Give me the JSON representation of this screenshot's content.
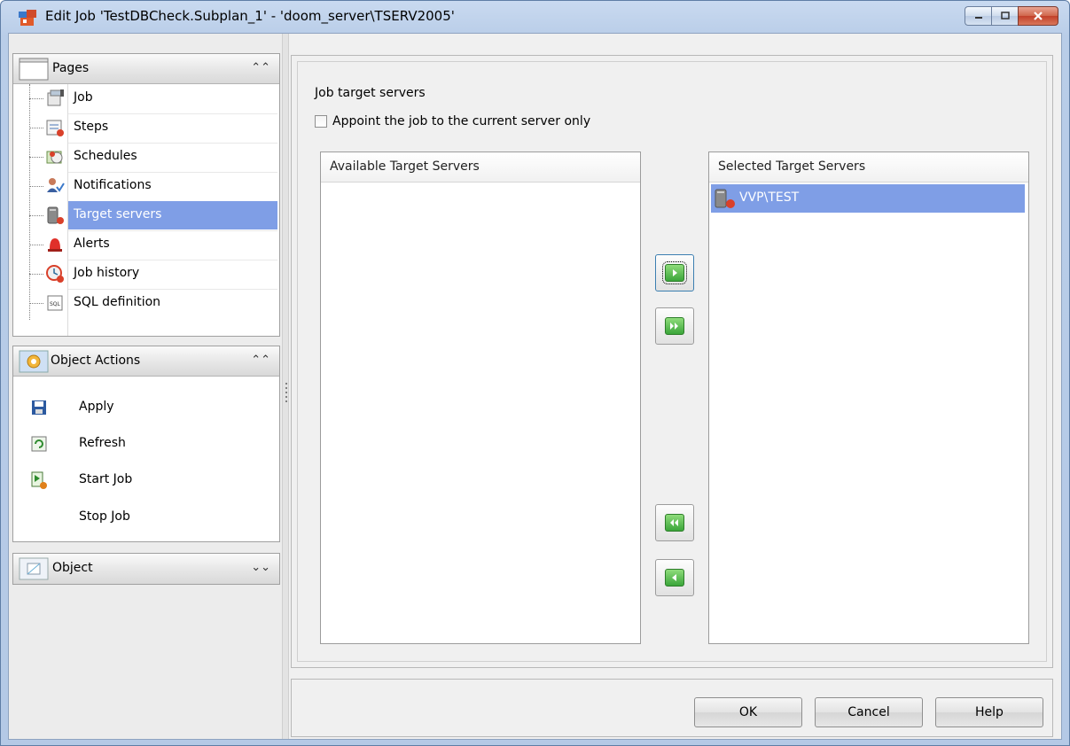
{
  "window": {
    "title": "Edit Job 'TestDBCheck.Subplan_1' - 'doom_server\\TSERV2005'"
  },
  "left_panel": {
    "pages": {
      "header": "Pages",
      "items": [
        {
          "label": "Job",
          "icon": "job-icon"
        },
        {
          "label": "Steps",
          "icon": "steps-icon"
        },
        {
          "label": "Schedules",
          "icon": "schedules-icon"
        },
        {
          "label": "Notifications",
          "icon": "notifications-icon"
        },
        {
          "label": "Target servers",
          "icon": "target-servers-icon",
          "selected": true
        },
        {
          "label": "Alerts",
          "icon": "alerts-icon"
        },
        {
          "label": "Job history",
          "icon": "job-history-icon"
        },
        {
          "label": "SQL definition",
          "icon": "sql-definition-icon"
        }
      ]
    },
    "object_actions": {
      "header": "Object Actions",
      "items": [
        {
          "label": "Apply",
          "icon": "save-icon"
        },
        {
          "label": "Refresh",
          "icon": "refresh-icon"
        },
        {
          "label": "Start Job",
          "icon": "start-job-icon"
        },
        {
          "label": "Stop Job",
          "icon": ""
        }
      ]
    },
    "object": {
      "header": "Object"
    }
  },
  "main": {
    "section_title": "Job target servers",
    "checkbox_label": "Appoint the job to the current server only",
    "checkbox_checked": false,
    "available_header": "Available Target Servers",
    "available_items": [],
    "selected_header": "Selected Target Servers",
    "selected_items": [
      {
        "label": "VVP\\TEST",
        "icon": "server-icon"
      }
    ]
  },
  "buttons": {
    "ok": "OK",
    "cancel": "Cancel",
    "help": "Help"
  },
  "colors": {
    "selection": "#7f9ee6",
    "title_gradient": "#c9daf0",
    "close_button": "#c2402a",
    "arrow_green": "#3ba53a"
  }
}
